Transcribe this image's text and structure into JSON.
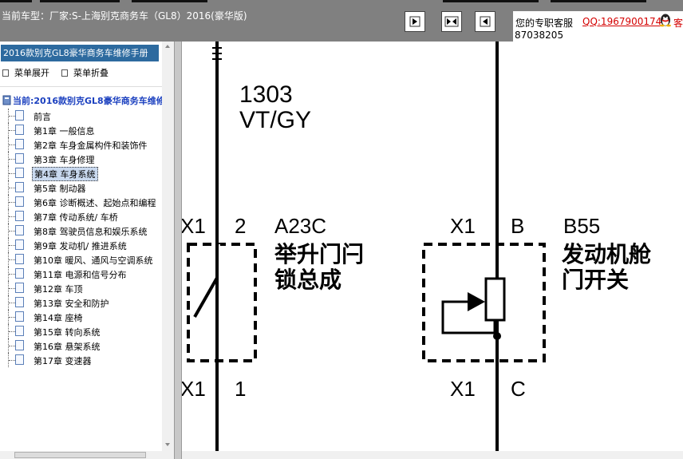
{
  "header": {
    "title": "当前车型：厂家:S-上海别克商务车（GL8）2016(豪华版)",
    "nav_buttons": [
      "nav-first-icon",
      "nav-fit-icon",
      "nav-last-icon"
    ]
  },
  "support": {
    "label": "您的专职客服",
    "qq_link": "QQ:1967900174",
    "number_line": "87038205",
    "icon": "qq-penguin-icon",
    "more": "客"
  },
  "sidebar": {
    "manual_title": "2016款别克GL8豪华商务车维修手册",
    "expand_label": "菜单展开",
    "collapse_label": "菜单折叠",
    "current_root": "当前:2016款别克GL8豪华商务车维修手册",
    "selected_index": 4,
    "items": [
      "前言",
      "第1章 一般信息",
      "第2章 车身金属构件和装饰件",
      "第3章 车身修理",
      "第4章 车身系统",
      "第5章 制动器",
      "第6章 诊断概述、起始点和编程",
      "第7章 传动系统/ 车桥",
      "第8章 驾驶员信息和娱乐系统",
      "第9章 发动机/ 推进系统",
      "第10章 暖风、通风与空调系统",
      "第11章 电源和信号分布",
      "第12章 车顶",
      "第13章 安全和防护",
      "第14章 座椅",
      "第15章 转向系统",
      "第16章 悬架系统",
      "第17章 变速器"
    ]
  },
  "diagram": {
    "wire_number": "1303",
    "wire_color": "VT/GY",
    "left_component": {
      "connector_top": "X1",
      "pin_top": "2",
      "code": "A23C",
      "name_line1": "举升门闩",
      "name_line2": "锁总成",
      "connector_bottom": "X1",
      "pin_bottom": "1"
    },
    "right_component": {
      "connector_top": "X1",
      "pin_top": "B",
      "code": "B55",
      "name_line1": "发动机舱",
      "name_line2": "门开关",
      "connector_bottom": "X1",
      "pin_bottom": "C"
    }
  }
}
